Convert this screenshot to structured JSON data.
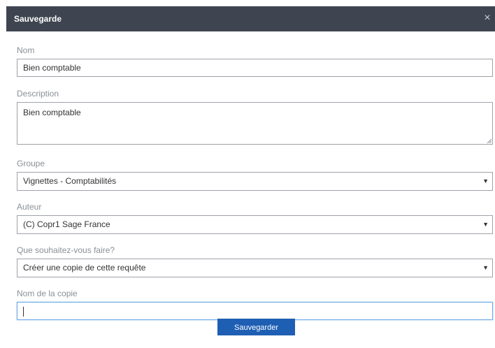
{
  "dialog": {
    "title": "Sauvegarde",
    "close_glyph": "×",
    "header_color": "#3f4550"
  },
  "fields": {
    "name": {
      "label": "Nom",
      "value": "Bien comptable"
    },
    "description": {
      "label": "Description",
      "value": "Bien comptable"
    },
    "group": {
      "label": "Groupe",
      "value": "Vignettes - Comptabilités"
    },
    "author": {
      "label": "Auteur",
      "value": "(C) Copr1 Sage France"
    },
    "action": {
      "label": "Que souhaitez-vous faire?",
      "value": "Créer une copie de cette requête"
    },
    "copy_name": {
      "label": "Nom de la copie",
      "value": ""
    }
  },
  "icons": {
    "close": "close-icon",
    "dropdown": "chevron-down-icon",
    "resize": "resize-grip-icon"
  },
  "dropdown_glyph": "▼",
  "save_button": {
    "label": "Sauvegarder",
    "color": "#1e5fb4"
  }
}
